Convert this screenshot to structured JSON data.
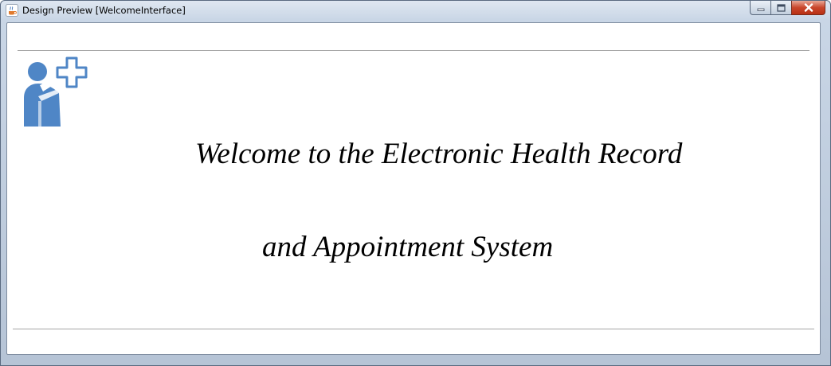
{
  "window": {
    "title": "Design Preview [WelcomeInterface]"
  },
  "icons": {
    "app": "java-coffee-cup-icon",
    "logo": "patient-with-medical-cross-icon",
    "minimize": "minimize-icon",
    "maximize": "maximize-icon",
    "close": "close-icon"
  },
  "colors": {
    "logo_blue": "#4f86c6",
    "close_red": "#c9462c"
  },
  "welcome": {
    "line1": "Welcome to the Electronic Health Record",
    "line2": "and Appointment System"
  }
}
